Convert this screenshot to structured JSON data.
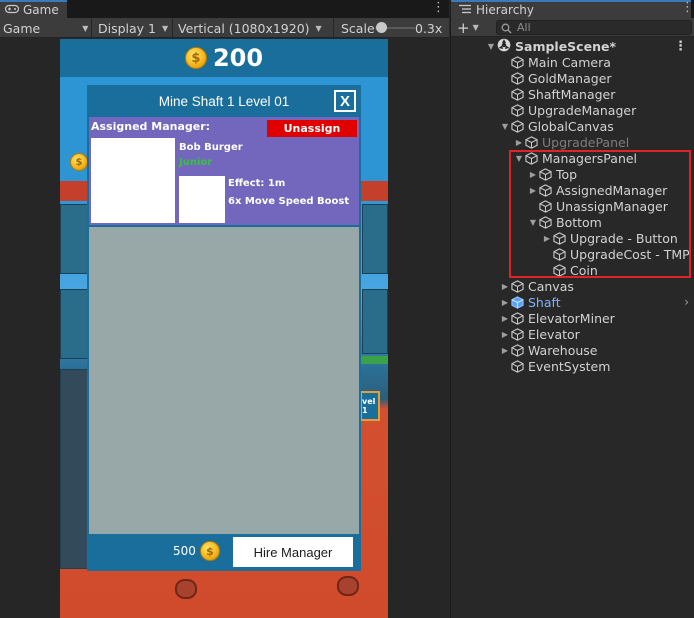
{
  "game_window": {
    "tab_label": "Game",
    "toolbar": {
      "mode": "Game",
      "display": "Display 1",
      "resolution": "Vertical (1080x1920)",
      "scale_label": "Scale",
      "scale_value": "0.3x"
    }
  },
  "game_view": {
    "gold_amount": "200",
    "managers_panel": {
      "title": "Mine Shaft 1 Level 01",
      "close_label": "X",
      "assigned_label": "Assigned Manager:",
      "unassign_label": "Unassign",
      "manager_name": "Bob Burger",
      "manager_rank": "Junior",
      "effect": "Effect: 1m",
      "boost": "6x Move Speed Boost",
      "hire_cost": "500",
      "hire_label": "Hire Manager"
    },
    "level_badge": "vel\n1"
  },
  "hierarchy": {
    "tab_label": "Hierarchy",
    "search_placeholder": "All",
    "scene": "SampleScene*",
    "items": [
      {
        "label": "Main Camera",
        "depth": 1,
        "expand": "none",
        "style": "normal"
      },
      {
        "label": "GoldManager",
        "depth": 1,
        "expand": "none",
        "style": "normal"
      },
      {
        "label": "ShaftManager",
        "depth": 1,
        "expand": "none",
        "style": "normal"
      },
      {
        "label": "UpgradeManager",
        "depth": 1,
        "expand": "none",
        "style": "normal"
      },
      {
        "label": "GlobalCanvas",
        "depth": 1,
        "expand": "open",
        "style": "normal"
      },
      {
        "label": "UpgradePanel",
        "depth": 2,
        "expand": "closed",
        "style": "dim"
      },
      {
        "label": "ManagersPanel",
        "depth": 2,
        "expand": "open",
        "style": "normal"
      },
      {
        "label": "Top",
        "depth": 3,
        "expand": "closed",
        "style": "normal"
      },
      {
        "label": "AssignedManager",
        "depth": 3,
        "expand": "closed",
        "style": "normal"
      },
      {
        "label": "UnassignManager",
        "depth": 3,
        "expand": "none",
        "style": "normal"
      },
      {
        "label": "Bottom",
        "depth": 3,
        "expand": "open",
        "style": "normal"
      },
      {
        "label": "Upgrade - Button",
        "depth": 4,
        "expand": "closed",
        "style": "normal"
      },
      {
        "label": "UpgradeCost - TMP",
        "depth": 4,
        "expand": "none",
        "style": "normal"
      },
      {
        "label": "Coin",
        "depth": 4,
        "expand": "none",
        "style": "normal"
      },
      {
        "label": "Canvas",
        "depth": 1,
        "expand": "closed",
        "style": "normal"
      },
      {
        "label": "Shaft",
        "depth": 1,
        "expand": "closed",
        "style": "blue"
      },
      {
        "label": "ElevatorMiner",
        "depth": 1,
        "expand": "closed",
        "style": "normal"
      },
      {
        "label": "Elevator",
        "depth": 1,
        "expand": "closed",
        "style": "normal"
      },
      {
        "label": "Warehouse",
        "depth": 1,
        "expand": "closed",
        "style": "normal"
      },
      {
        "label": "EventSystem",
        "depth": 1,
        "expand": "none",
        "style": "normal"
      }
    ]
  },
  "colors": {
    "panel_blue": "#1a6e9b",
    "assigned_bg": "#7266bd",
    "unassign_red": "#e00000",
    "rank_green": "#36c33c",
    "highlight_red": "#e0232b",
    "prefab_blue": "#7fb1ff"
  }
}
